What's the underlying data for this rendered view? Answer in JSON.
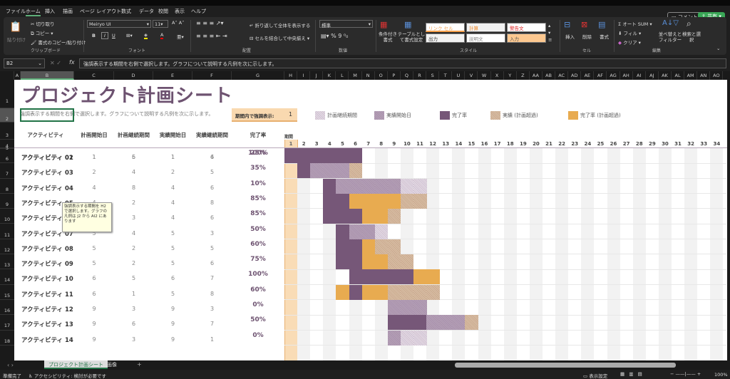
{
  "menu": {
    "tabs": [
      "ファイル",
      "ホーム",
      "挿入",
      "描画",
      "ページ レイアウト",
      "数式",
      "データ",
      "校閲",
      "表示",
      "ヘルプ"
    ],
    "active": 1,
    "comment": "コメント",
    "share": "共有"
  },
  "ribbon": {
    "clipboard": {
      "paste": "貼り付け",
      "cut": "切り取り",
      "copy": "コピー",
      "format_painter": "書式のコピー/貼り付け",
      "label": "クリップボード"
    },
    "font": {
      "name": "Meiryo UI",
      "size": "11",
      "bold": "B",
      "italic": "I",
      "underline": "U",
      "label": "フォント"
    },
    "alignment": {
      "wrap": "折り返して全体を表示する",
      "merge": "セルを結合して中央揃え",
      "label": "配置"
    },
    "number": {
      "format": "標準",
      "percent": "%",
      "comma": "9",
      "label": "数値"
    },
    "styles": {
      "cond": "条件付き書式",
      "table": "テーブルとして書式設定",
      "cells": [
        "リンク セル",
        "計算",
        "警告文",
        "出力",
        "説明文",
        "入力"
      ],
      "label": "スタイル"
    },
    "cells": {
      "insert": "挿入",
      "delete": "削除",
      "format": "書式",
      "label": "セル"
    },
    "editing": {
      "autosum": "オート SUM",
      "fill": "フィル",
      "clear": "クリア",
      "sort": "並べ替えとフィルター",
      "find": "検索と選択",
      "label": "編集"
    }
  },
  "formula_bar": {
    "name_box": "B2",
    "fx": "fx",
    "formula": "強調表示する期間を右側で選択します。グラフについて説明する凡例を次に示します。"
  },
  "columns": [
    "A",
    "B",
    "C",
    "D",
    "E",
    "F",
    "G",
    "H",
    "I",
    "J",
    "K",
    "L",
    "M",
    "N",
    "O",
    "P",
    "Q",
    "R",
    "S",
    "T",
    "U",
    "V",
    "W",
    "X",
    "Y",
    "Z",
    "AA",
    "AB",
    "AC",
    "AD",
    "AE",
    "AF",
    "AG",
    "AH",
    "AI",
    "AJ",
    "AK",
    "AL",
    "AM",
    "AN",
    "AO"
  ],
  "rows": [
    "1",
    "2",
    "3",
    "4",
    "5",
    "6",
    "7",
    "8",
    "9",
    "10",
    "11",
    "12",
    "13",
    "14",
    "15",
    "16",
    "17",
    "18"
  ],
  "sheet": {
    "title": "プロジェクト計画シート",
    "subtitle": "強調表示する期間を右側で選択します。グラフについて説明する凡例を次に示します。",
    "highlight_label": "期間内で強調表示:",
    "highlight_value": "1",
    "legend": [
      {
        "label": "計画継続期間",
        "cls": "L"
      },
      {
        "label": "実績開始日",
        "cls": "A"
      },
      {
        "label": "完了率",
        "cls": "D"
      },
      {
        "label": "実績 (計画超過)",
        "cls": "X"
      },
      {
        "label": "完了率 (計画超過)",
        "cls": "O"
      }
    ],
    "headers": [
      "アクティビティ",
      "計画開始日",
      "計画継続期間",
      "実績開始日",
      "実績継続期間",
      "完了率"
    ],
    "period_label": "期間",
    "periods": [
      "1",
      "2",
      "3",
      "4",
      "5",
      "6",
      "7",
      "8",
      "9",
      "10",
      "11",
      "12",
      "13",
      "14",
      "15",
      "16",
      "17",
      "18",
      "19",
      "20",
      "21",
      "22",
      "23",
      "24",
      "25",
      "26",
      "27",
      "28",
      "29",
      "30",
      "31",
      "32",
      "33",
      "34"
    ],
    "activities": [
      {
        "name": "アクティビティ 01",
        "plan_start": "1",
        "plan_dur": "5",
        "act_start": "1",
        "act_dur": "4",
        "pct": "25%",
        "bars": "DAAAL"
      },
      {
        "name": "アクティビティ 02",
        "plan_start": "1",
        "plan_dur": "6",
        "act_start": "1",
        "act_dur": "6",
        "pct": "100%",
        "bars": "DDDDDD"
      },
      {
        "name": "アクティビティ 03",
        "plan_start": "2",
        "plan_dur": "4",
        "act_start": "2",
        "act_dur": "5",
        "pct": "35%",
        "bars": ".DAAAX"
      },
      {
        "name": "アクティビティ 04",
        "plan_start": "4",
        "plan_dur": "8",
        "act_start": "4",
        "act_dur": "6",
        "pct": "10%",
        "bars": "...DAAAAALL"
      },
      {
        "name": "アクティビティ 05",
        "plan_start": "4",
        "plan_dur": "2",
        "act_start": "4",
        "act_dur": "8",
        "pct": "85%",
        "bars": "...DDOOOOXX"
      },
      {
        "name": "アクティビティ 06",
        "plan_start": "4",
        "plan_dur": "3",
        "act_start": "4",
        "act_dur": "6",
        "pct": "85%",
        "bars": "...DDDOOX"
      },
      {
        "name": "アクティビティ 07",
        "plan_start": "5",
        "plan_dur": "4",
        "act_start": "5",
        "act_dur": "3",
        "pct": "50%",
        "bars": "....DAAL"
      },
      {
        "name": "アクティビティ 08",
        "plan_start": "5",
        "plan_dur": "2",
        "act_start": "5",
        "act_dur": "5",
        "pct": "60%",
        "bars": "....DDOXX"
      },
      {
        "name": "アクティビティ 09",
        "plan_start": "5",
        "plan_dur": "2",
        "act_start": "5",
        "act_dur": "6",
        "pct": "75%",
        "bars": "....DDOOXX"
      },
      {
        "name": "アクティビティ 10",
        "plan_start": "6",
        "plan_dur": "5",
        "act_start": "6",
        "act_dur": "7",
        "pct": "100%",
        "bars": ".....DDDDDOO"
      },
      {
        "name": "アクティビティ 11",
        "plan_start": "6",
        "plan_dur": "1",
        "act_start": "5",
        "act_dur": "8",
        "pct": "60%",
        "bars": "....ODOOXXXX"
      },
      {
        "name": "アクティビティ 12",
        "plan_start": "9",
        "plan_dur": "3",
        "act_start": "9",
        "act_dur": "3",
        "pct": "0%",
        "bars": "........AAA"
      },
      {
        "name": "アクティビティ 13",
        "plan_start": "9",
        "plan_dur": "6",
        "act_start": "9",
        "act_dur": "7",
        "pct": "50%",
        "bars": "........DDDAAAX"
      },
      {
        "name": "アクティビティ 14",
        "plan_start": "9",
        "plan_dur": "3",
        "act_start": "9",
        "act_dur": "1",
        "pct": "0%",
        "bars": "........ALL"
      }
    ],
    "tooltip": "強調表示する期間を H2 で選択します。グラフの凡例は J2 から AI2 にあります"
  },
  "tabs": {
    "sheets": [
      "プロジェクト計画シート",
      "画像"
    ],
    "add": "+"
  },
  "status": {
    "ready": "準備完了",
    "accessibility": "アクセシビリティ: 検討が必要です",
    "display": "表示設定",
    "zoom": "100%"
  }
}
